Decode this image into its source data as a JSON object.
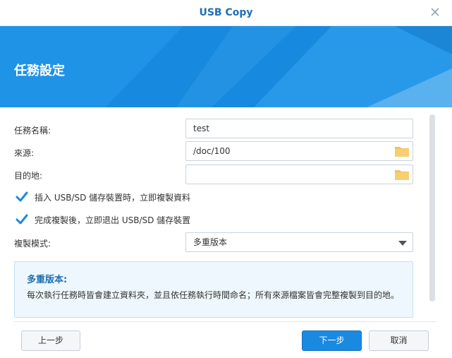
{
  "window": {
    "title": "USB Copy"
  },
  "banner": {
    "heading": "任務設定"
  },
  "form": {
    "task_name": {
      "label": "任務名稱:",
      "value": "test"
    },
    "source": {
      "label": "來源:",
      "value": "/doc/100"
    },
    "destination": {
      "label": "目的地:",
      "value": ""
    },
    "auto_copy": {
      "label": "插入 USB/SD 儲存裝置時，立即複製資料",
      "checked": true
    },
    "auto_eject": {
      "label": "完成複製後，立即退出 USB/SD 儲存裝置",
      "checked": true
    },
    "copy_mode": {
      "label": "複製模式:",
      "selected": "多重版本"
    }
  },
  "info": {
    "title": "多重版本:",
    "text": "每次執行任務時皆會建立資料夾，並且依任務執行時間命名；所有來源檔案皆會完整複製到目的地。"
  },
  "footer": {
    "back_label": "上一步",
    "next_label": "下一步",
    "cancel_label": "取消"
  },
  "colors": {
    "accent": "#1a8ae0",
    "banner": "#1a8fe3",
    "folder": "#f2c25c",
    "title": "#1f6fb3"
  },
  "icons": {
    "close": "close-icon",
    "folder": "folder-icon",
    "checkbox": "checkbox-checked-icon",
    "dropdown": "chevron-down-icon"
  }
}
